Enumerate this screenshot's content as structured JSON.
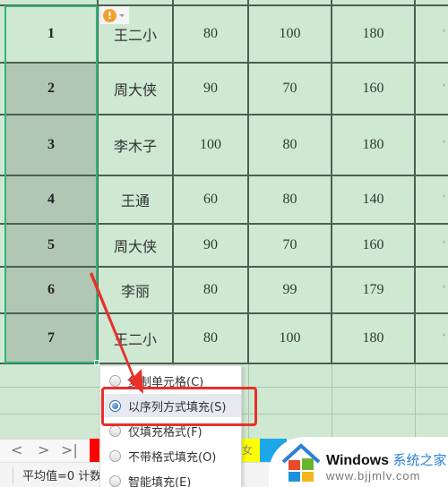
{
  "table": {
    "rows": [
      {
        "index": "1",
        "name": "王二小",
        "c1": "80",
        "c2": "100",
        "c3": "180"
      },
      {
        "index": "2",
        "name": "周大侠",
        "c1": "90",
        "c2": "70",
        "c3": "160"
      },
      {
        "index": "3",
        "name": "李木子",
        "c1": "100",
        "c2": "80",
        "c3": "180"
      },
      {
        "index": "4",
        "name": "王通",
        "c1": "60",
        "c2": "80",
        "c3": "140"
      },
      {
        "index": "5",
        "name": "周大侠",
        "c1": "90",
        "c2": "70",
        "c3": "160"
      },
      {
        "index": "6",
        "name": "李丽",
        "c1": "80",
        "c2": "99",
        "c3": "179"
      },
      {
        "index": "7",
        "name": "王二小",
        "c1": "80",
        "c2": "100",
        "c3": "180"
      }
    ]
  },
  "autofill_button": {
    "icon": "warning-icon",
    "glyph": "!"
  },
  "fill_menu": {
    "items": [
      {
        "label": "复制单元格(C)",
        "selected": false
      },
      {
        "label": "以序列方式填充(S)",
        "selected": true
      },
      {
        "label": "仅填充格式(F)",
        "selected": false
      },
      {
        "label": "不带格式填充(O)",
        "selected": false
      },
      {
        "label": "智能填充(E)",
        "selected": false
      }
    ]
  },
  "sheet_nav": {
    "prev": "<",
    "next": ">",
    "last": ">|"
  },
  "sheet_tabs": {
    "partial_label": "女"
  },
  "status_bar": {
    "text": "平均值=0  计数"
  },
  "watermark": {
    "brand": "Windows",
    "brand_cn": "系统之家",
    "url": "www.bjjmlv.com"
  },
  "colors": {
    "cell_bg": "#cfe8d2",
    "selected_bg": "#b1c7b3",
    "selection_border": "#2fb57a",
    "highlight": "#e8302a",
    "arrow": "#e8302a"
  }
}
